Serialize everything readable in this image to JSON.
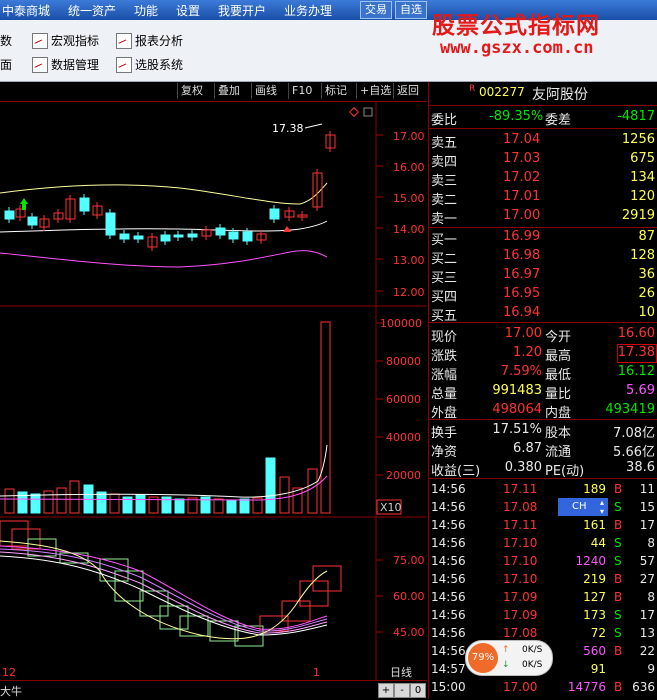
{
  "menubar": {
    "items": [
      "中泰商城",
      "统一资产",
      "功能",
      "设置",
      "我要开户",
      "业务办理"
    ],
    "buttons": [
      "交易",
      "自选"
    ]
  },
  "toolbar": {
    "row1": [
      "数",
      "宏观指标",
      "报表分析"
    ],
    "row2": [
      "面",
      "数据管理",
      "选股系统"
    ]
  },
  "watermark": {
    "line1": "股票公式指标网",
    "line2": "www.gszx.com.cn"
  },
  "chartbar": {
    "buttons": [
      "复权",
      "叠加",
      "画线",
      "F10",
      "标记",
      "+自选",
      "返回"
    ]
  },
  "price_chart": {
    "y_ticks": [
      "17.00",
      "16.00",
      "15.00",
      "14.00",
      "13.00",
      "12.00"
    ],
    "high_label": "17.38",
    "colors": {
      "up": "#ff3232",
      "down": "#54ffff",
      "ma1": "#ffffa0",
      "ma2": "#ffffff",
      "ma3": "#ff54ff"
    }
  },
  "volume_chart": {
    "y_ticks": [
      "100000",
      "80000",
      "60000",
      "40000",
      "20000"
    ],
    "unit_label": "X10"
  },
  "indicator_chart": {
    "y_ticks": [
      "75.00",
      "60.00",
      "45.00"
    ]
  },
  "bottom": {
    "left_label": "大牛",
    "date_left": "12",
    "date_right": "1",
    "period": "日线",
    "nav": [
      "+",
      "-",
      "0"
    ]
  },
  "quote": {
    "code": "002277",
    "name": "友阿股份",
    "flag": "R",
    "weibi_label": "委比",
    "weibi_value": "-89.35%",
    "weicha_label": "委差",
    "weicha_value": "-4817",
    "asks": [
      {
        "label": "卖五",
        "price": "17.04",
        "vol": "1256"
      },
      {
        "label": "卖四",
        "price": "17.03",
        "vol": "675"
      },
      {
        "label": "卖三",
        "price": "17.02",
        "vol": "134"
      },
      {
        "label": "卖二",
        "price": "17.01",
        "vol": "120"
      },
      {
        "label": "卖一",
        "price": "17.00",
        "vol": "2919"
      }
    ],
    "bids": [
      {
        "label": "买一",
        "price": "16.99",
        "vol": "87"
      },
      {
        "label": "买二",
        "price": "16.98",
        "vol": "128"
      },
      {
        "label": "买三",
        "price": "16.97",
        "vol": "36"
      },
      {
        "label": "买四",
        "price": "16.95",
        "vol": "26"
      },
      {
        "label": "买五",
        "price": "16.94",
        "vol": "10"
      }
    ],
    "stats": [
      {
        "l1": "现价",
        "v1": "17.00",
        "l2": "今开",
        "v2": "16.60"
      },
      {
        "l1": "涨跌",
        "v1": "1.20",
        "l2": "最高",
        "v2": "17.38"
      },
      {
        "l1": "涨幅",
        "v1": "7.59%",
        "l2": "最低",
        "v2": "16.12"
      },
      {
        "l1": "总量",
        "v1": "991483",
        "l2": "量比",
        "v2": "5.69"
      },
      {
        "l1": "外盘",
        "v1": "498064",
        "l2": "内盘",
        "v2": "493419"
      }
    ],
    "fin": [
      {
        "l1": "换手",
        "v1": "17.51%",
        "l2": "股本",
        "v2": "7.08亿"
      },
      {
        "l1": "净资",
        "v1": "6.87",
        "l2": "流通",
        "v2": "5.66亿"
      },
      {
        "l1": "收益(三)",
        "v1": "0.380",
        "l2": "PE(动)",
        "v2": "38.6"
      }
    ],
    "ticks": [
      {
        "t": "14:56",
        "p": "17.11",
        "v": "189",
        "s": "B",
        "n": "11"
      },
      {
        "t": "14:56",
        "p": "17.08",
        "v": "",
        "s": "S",
        "n": "15"
      },
      {
        "t": "14:56",
        "p": "17.11",
        "v": "161",
        "s": "B",
        "n": "17"
      },
      {
        "t": "14:56",
        "p": "17.10",
        "v": "44",
        "s": "S",
        "n": "8"
      },
      {
        "t": "14:56",
        "p": "17.10",
        "v": "1240",
        "s": "S",
        "n": "57"
      },
      {
        "t": "14:56",
        "p": "17.10",
        "v": "219",
        "s": "B",
        "n": "27"
      },
      {
        "t": "14:56",
        "p": "17.09",
        "v": "127",
        "s": "B",
        "n": "8"
      },
      {
        "t": "14:56",
        "p": "17.09",
        "v": "173",
        "s": "S",
        "n": "17"
      },
      {
        "t": "14:56",
        "p": "17.08",
        "v": "72",
        "s": "S",
        "n": "13"
      },
      {
        "t": "14:56",
        "p": "",
        "v": "560",
        "s": "B",
        "n": "22"
      },
      {
        "t": "14:57",
        "p": "",
        "v": "91",
        "s": "",
        "n": "9"
      },
      {
        "t": "15:00",
        "p": "17.00",
        "v": "14776",
        "s": "B",
        "n": "636"
      }
    ],
    "ch_label": "CH"
  },
  "speed": {
    "percent": "79%",
    "up": "0K/S",
    "down": "0K/S"
  }
}
